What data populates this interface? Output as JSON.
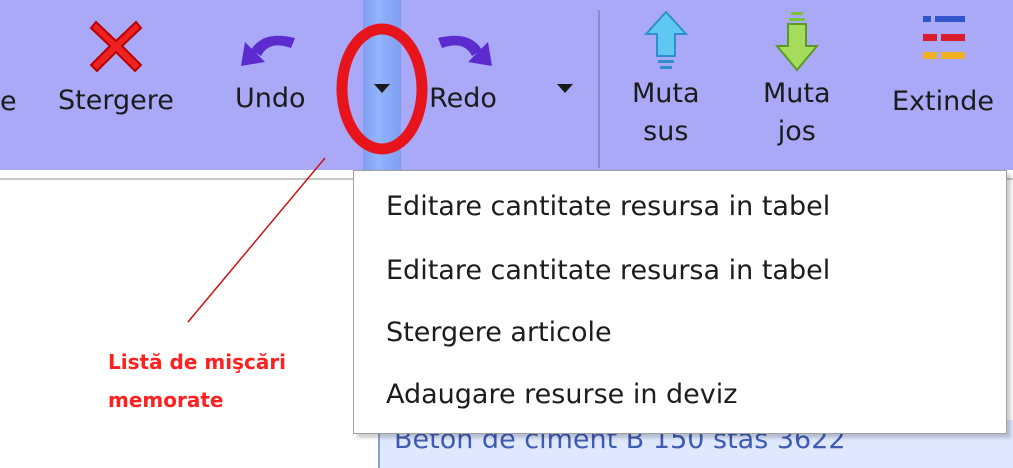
{
  "toolbar": {
    "partial_label": "e",
    "delete": {
      "label": "Stergere",
      "icon": "red-x-icon"
    },
    "undo": {
      "label": "Undo",
      "icon": "undo-arrow-icon"
    },
    "redo": {
      "label": "Redo",
      "icon": "redo-arrow-icon"
    },
    "move_up": {
      "label_line1": "Muta",
      "label_line2": "sus",
      "icon": "move-up-arrow-icon"
    },
    "move_down": {
      "label_line1": "Muta",
      "label_line2": "jos",
      "icon": "move-down-arrow-icon"
    },
    "expand": {
      "label": "Extinde",
      "icon": "expand-lines-icon"
    }
  },
  "undo_history_menu": {
    "items": [
      "Editare cantitate resursa in tabel",
      "Editare cantitate resursa in tabel",
      "Stergere articole",
      "Adaugare resurse in deviz"
    ]
  },
  "background_row_text": "Beton de ciment   B 150   stas 3622",
  "annotation": {
    "line1": "Listă de mişcări",
    "line2": "memorate",
    "color": "#ff2020"
  },
  "colors": {
    "toolbar_bg": "#a9a9f7",
    "split_separator": "#93b4ff",
    "annotation_circle": "#e8141c"
  }
}
